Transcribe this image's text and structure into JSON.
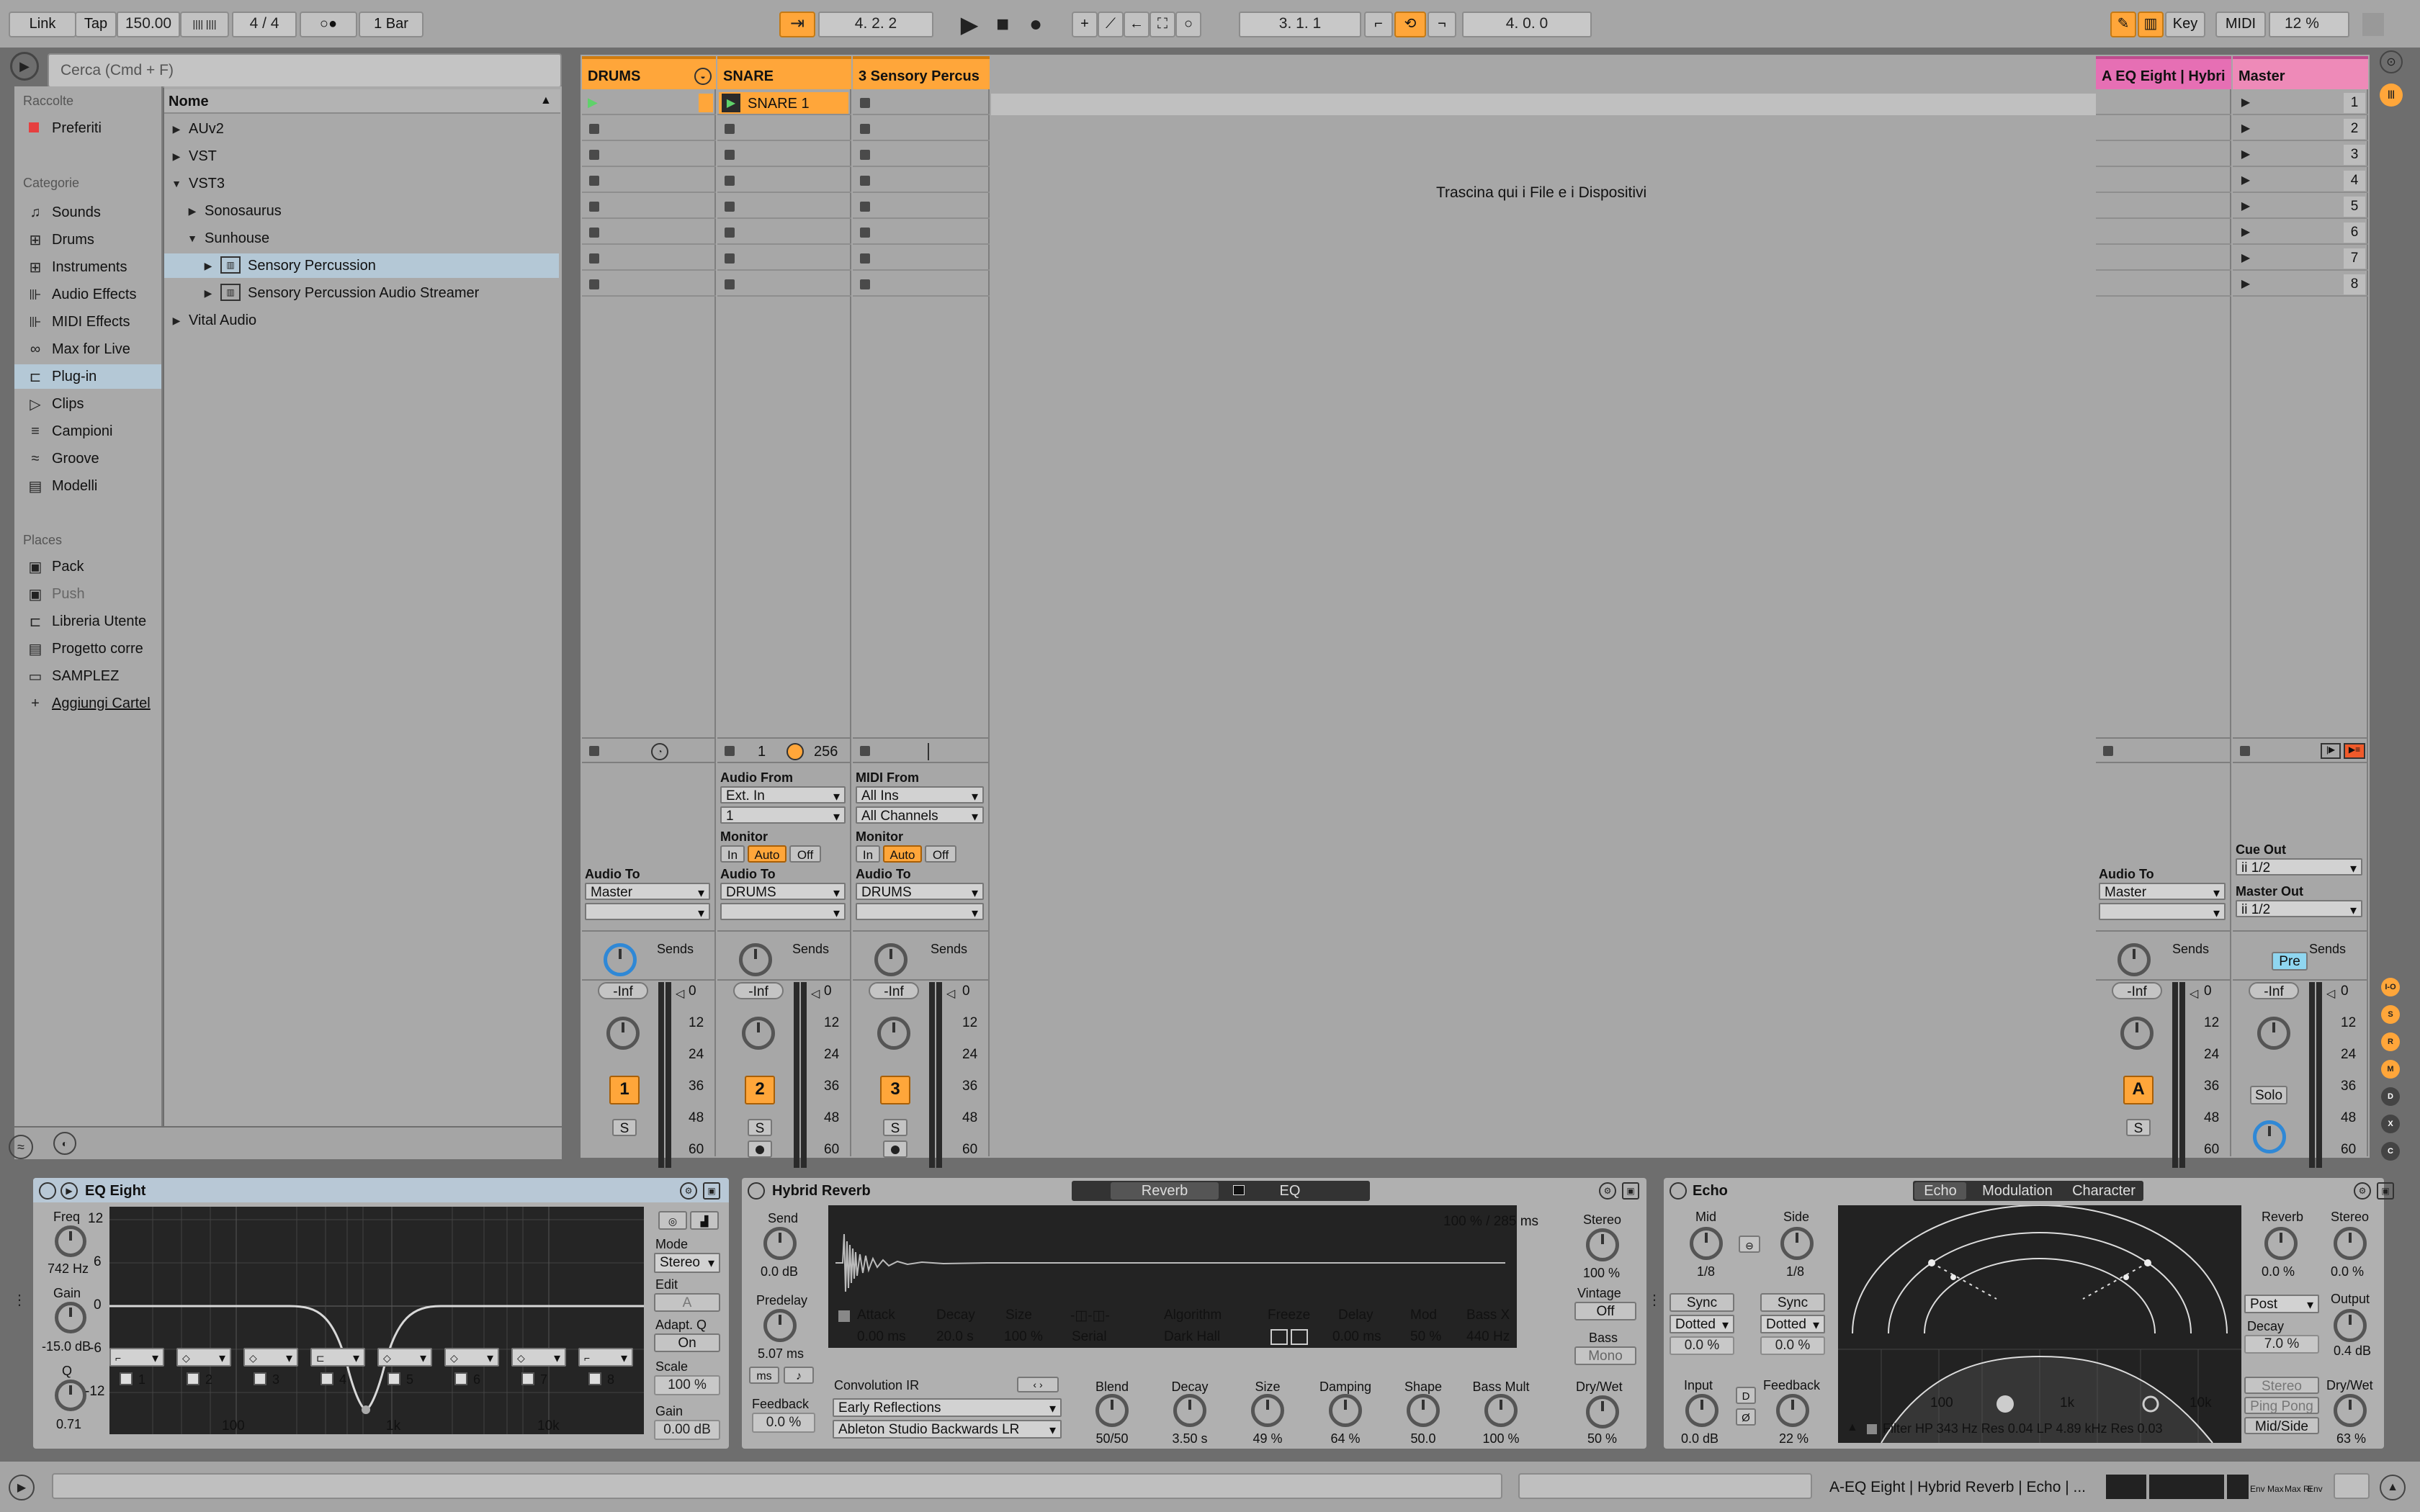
{
  "transport": {
    "link": "Link",
    "tap": "Tap",
    "tempo": "150.00",
    "metronome_glyph": "|||| ||||",
    "signature": "4 / 4",
    "follow": "○●",
    "quantize": "1 Bar",
    "position": "4.   2.   2",
    "loop_start": "3.   1.   1",
    "loop_length": "4.   0.   0",
    "key": "Key",
    "midi": "MIDI",
    "cpu": "12 %"
  },
  "browser": {
    "search_placeholder": "Cerca (Cmd + F)",
    "collections_header": "Raccolte",
    "favorites": "Preferiti",
    "categories_header": "Categorie",
    "categories": [
      "Sounds",
      "Drums",
      "Instruments",
      "Audio Effects",
      "MIDI Effects",
      "Max for Live",
      "Plug-in",
      "Clips",
      "Campioni",
      "Groove",
      "Modelli"
    ],
    "places_header": "Places",
    "places": [
      "Pack",
      "Push",
      "Libreria Utente",
      "Progetto corre",
      "SAMPLEZ",
      "Aggiungi Cartel"
    ],
    "name_header": "Nome",
    "tree": [
      "AUv2",
      "VST",
      "VST3",
      "Sonosaurus",
      "Sunhouse",
      "Sensory Percussion",
      "Sensory Percussion Audio Streamer",
      "Vital Audio"
    ]
  },
  "session": {
    "drop_hint": "Trascina qui i File e i Dispositivi",
    "tracks": [
      {
        "name": "DRUMS",
        "num": "1"
      },
      {
        "name": "SNARE",
        "num": "2",
        "clip": "SNARE 1"
      },
      {
        "name": "3 Sensory Percus",
        "num": "3"
      }
    ],
    "return": {
      "name": "A EQ Eight | Hybri",
      "num": "A"
    },
    "master": {
      "name": "Master"
    },
    "scenes": [
      "1",
      "2",
      "3",
      "4",
      "5",
      "6",
      "7",
      "8"
    ],
    "io": {
      "audio_to": "Audio To",
      "master": "Master",
      "drums": "DRUMS",
      "audio_from": "Audio From",
      "ext_in": "Ext. In",
      "ch1": "1",
      "monitor": "Monitor",
      "in": "In",
      "auto": "Auto",
      "off": "Off",
      "midi_from": "MIDI From",
      "all_ins": "All Ins",
      "all_channels": "All Channels",
      "cue_out": "Cue Out",
      "cue_val": "ii 1/2",
      "master_out": "Master Out",
      "master_val": "ii 1/2",
      "one": "1",
      "delay_val": "256"
    },
    "sends": "Sends",
    "inf": "-Inf",
    "solo_s": "S",
    "solo": "Solo",
    "pre": "Pre",
    "meter_scale": [
      "0",
      "12",
      "24",
      "36",
      "48",
      "60"
    ]
  },
  "devices": {
    "eq": {
      "title": "EQ Eight",
      "freq": "Freq",
      "freq_val": "742 Hz",
      "gain": "Gain",
      "gain_val": "-15.0 dB",
      "q": "Q",
      "q_val": "0.71",
      "mode": "Mode",
      "mode_val": "Stereo",
      "edit": "Edit",
      "edit_val": "A",
      "adapt": "Adapt. Q",
      "adapt_val": "On",
      "scale": "Scale",
      "scale_val": "100 %",
      "gain2": "Gain",
      "gain2_val": "0.00 dB",
      "y": [
        "12",
        "6",
        "0",
        "-6",
        "-12"
      ],
      "x": [
        "100",
        "1k",
        "10k"
      ],
      "bands": [
        "1",
        "2",
        "3",
        "4",
        "5",
        "6",
        "7",
        "8"
      ]
    },
    "reverb": {
      "title": "Hybrid Reverb",
      "tab1": "Reverb",
      "tab2": "EQ",
      "send": "Send",
      "send_val": "0.0 dB",
      "predelay": "Predelay",
      "predelay_val": "5.07 ms",
      "ms": "ms",
      "feedback": "Feedback",
      "feedback_val": "0.0 %",
      "ir_info": "100 % / 285 ms",
      "attack": "Attack",
      "attack_val": "0.00 ms",
      "decay": "Decay",
      "decay_val": "20.0 s",
      "size": "Size",
      "size_val": "100 %",
      "route_val": "Serial",
      "algorithm": "Algorithm",
      "algorithm_val": "Dark Hall",
      "freeze": "Freeze",
      "delay": "Delay",
      "delay_val": "0.00 ms",
      "mod": "Mod",
      "mod_val": "50 %",
      "bassx": "Bass X",
      "bassx_val": "440 Hz",
      "conv": "Convolution IR",
      "early": "Early Reflections",
      "ir": "Ableton Studio Backwards LR",
      "blend": "Blend",
      "blend_val": "50/50",
      "decay2": "Decay",
      "decay2_val": "3.50 s",
      "size2": "Size",
      "size2_val": "49 %",
      "damping": "Damping",
      "damping_val": "64 %",
      "shape": "Shape",
      "shape_val": "50.0",
      "bassmult": "Bass Mult",
      "bassmult_val": "100 %",
      "stereo": "Stereo",
      "stereo_val": "100 %",
      "vintage": "Vintage",
      "vintage_val": "Off",
      "bass": "Bass",
      "bass_val": "Mono",
      "drywet": "Dry/Wet",
      "drywet_val": "50 %"
    },
    "echo": {
      "title": "Echo",
      "tab1": "Echo",
      "tab2": "Modulation",
      "tab3": "Character",
      "mid": "Mid",
      "mid_val": "1/8",
      "side": "Side",
      "side_val": "1/8",
      "sync": "Sync",
      "dotted": "Dotted",
      "pct": "0.0 %",
      "input": "Input",
      "input_val": "0.0 dB",
      "feedback": "Feedback",
      "feedback_val": "22 %",
      "d": "D",
      "phase": "Ø",
      "filter": "Filter HP 343 Hz   Res 0.04  LP 4.89 kHz  Res 0.03",
      "x": [
        "100",
        "1k",
        "10k"
      ],
      "reverb": "Reverb",
      "reverb_val": "0.0 %",
      "stereo": "Stereo",
      "stereo_val": "0.0 %",
      "post": "Post",
      "decay": "Decay",
      "decay_val": "7.0 %",
      "output": "Output",
      "output_val": "0.4 dB",
      "stereo_btn": "Stereo",
      "pingpong": "Ping Pong",
      "midside": "Mid/Side",
      "drywet": "Dry/Wet",
      "drywet_val": "63 %"
    }
  },
  "status": {
    "chain": "A-EQ Eight | Hybrid Reverb | Echo | ...",
    "mini": [
      "Env",
      "Max",
      "Max Ri",
      "Env"
    ]
  }
}
